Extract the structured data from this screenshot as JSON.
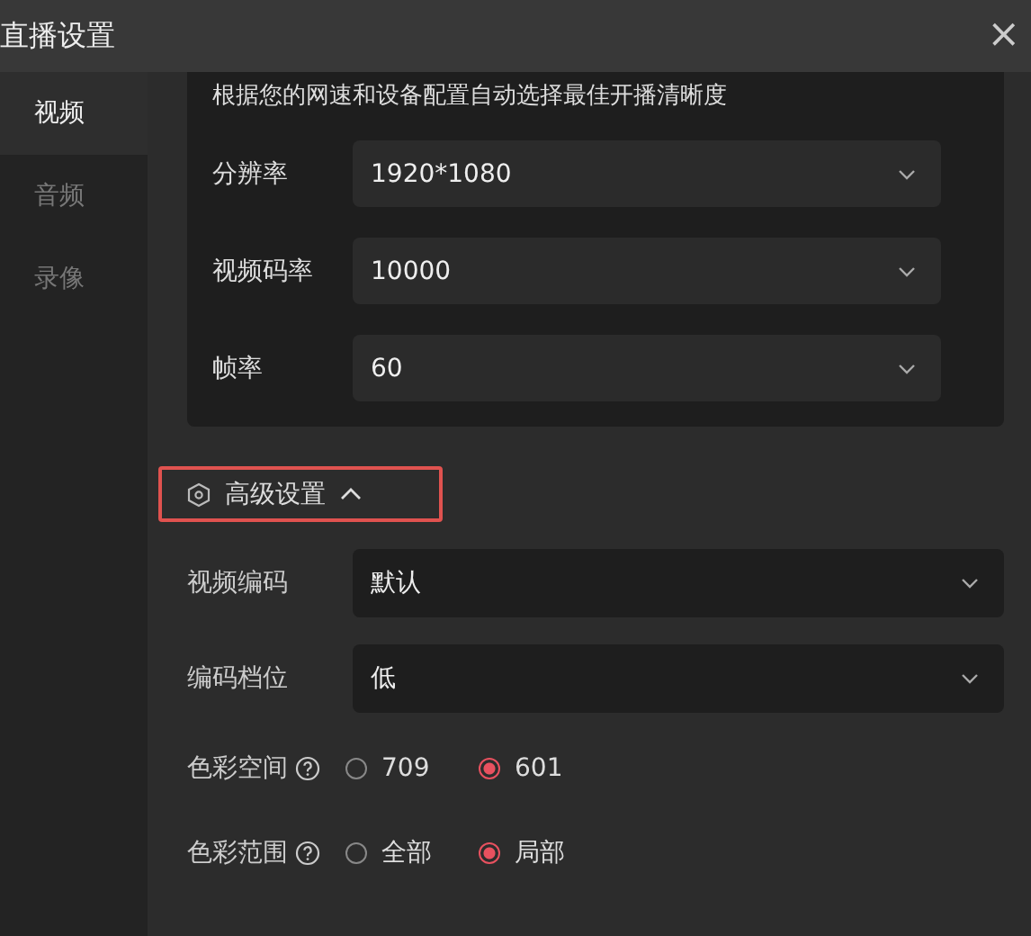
{
  "window": {
    "title": "直播设置",
    "close": "×"
  },
  "sidebar": {
    "items": [
      {
        "label": "视频",
        "selected": true
      },
      {
        "label": "音频",
        "selected": false
      },
      {
        "label": "录像",
        "selected": false
      }
    ]
  },
  "auto_panel": {
    "hint": "根据您的网速和设备配置自动选择最佳开播清晰度",
    "fields": [
      {
        "label": "分辨率",
        "value": "1920*1080"
      },
      {
        "label": "视频码率",
        "value": "10000"
      },
      {
        "label": "帧率",
        "value": "60"
      }
    ]
  },
  "advanced": {
    "label": "高级设置",
    "expanded": true,
    "fields": [
      {
        "label": "视频编码",
        "value": "默认"
      },
      {
        "label": "编码档位",
        "value": "低"
      }
    ],
    "radio_groups": [
      {
        "label": "色彩空间",
        "options": [
          {
            "label": "709",
            "selected": false
          },
          {
            "label": "601",
            "selected": true
          }
        ]
      },
      {
        "label": "色彩范围",
        "options": [
          {
            "label": "全部",
            "selected": false
          },
          {
            "label": "局部",
            "selected": true
          }
        ]
      }
    ]
  }
}
